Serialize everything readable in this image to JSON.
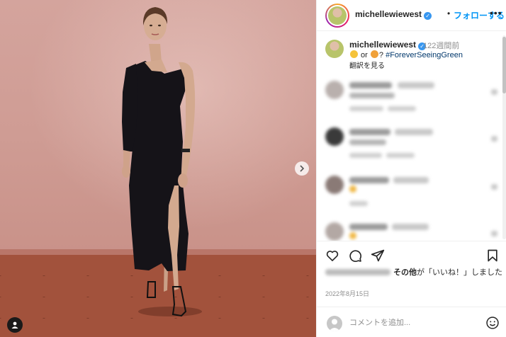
{
  "post": {
    "username": "michellewiewest",
    "follow_separator": "•",
    "follow_label": "フォローする",
    "more_label": "•••"
  },
  "caption": {
    "username": "michellewiewest",
    "time": "122週間前",
    "text_mid": " or ",
    "text_end": "? ",
    "hashtag": "#ForeverSeeingGreen",
    "translate": "翻訳を見る"
  },
  "likes": {
    "bold": "その他",
    "suffix": "が「いいね！」しました"
  },
  "date": "2022年8月15日",
  "comment_box": {
    "placeholder": "コメントを追加..."
  },
  "icons": [
    "heart-icon",
    "comment-icon",
    "share-icon",
    "bookmark-icon",
    "smiley-icon",
    "chevron-right-icon",
    "user-tag-icon"
  ],
  "colors": {
    "accent": "#0095f6",
    "hashtag": "#00376b",
    "text": "#262626",
    "muted": "#8e8e8e"
  }
}
